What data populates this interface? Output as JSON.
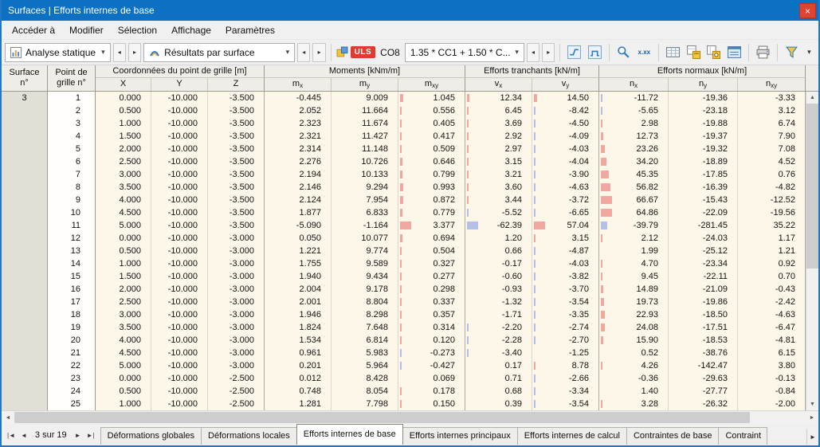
{
  "window": {
    "title": "Surfaces | Efforts internes de base"
  },
  "icons": {
    "close": "×",
    "chevron_down": "▾",
    "arrow_left": "◂",
    "arrow_right": "▸",
    "scroll_up": "▲",
    "scroll_down": "▼",
    "scroll_left": "◄",
    "scroll_right": "►",
    "nav_first": "|◄",
    "nav_prev": "◄",
    "nav_next": "►",
    "nav_last": "►|",
    "tab_scroll_right": "►",
    "decimal_places": "x.xx"
  },
  "menu": {
    "items": [
      "Accéder à",
      "Modifier",
      "Sélection",
      "Affichage",
      "Paramètres"
    ]
  },
  "toolbar": {
    "analysis_label": "Analyse statique",
    "results_label": "Résultats par surface",
    "design_situation": "ULS",
    "combination_id": "CO8",
    "combination_label": "1.35 * CC1 + 1.50 * C..."
  },
  "table": {
    "surface_header": "Surface\nn°",
    "point_header": "Point de\ngrille n°",
    "surface_number": "3",
    "groups": [
      {
        "label": "Coordonnées du point de grille [m]",
        "cols": [
          {
            "base": "X",
            "sub": ""
          },
          {
            "base": "Y",
            "sub": ""
          },
          {
            "base": "Z",
            "sub": ""
          }
        ]
      },
      {
        "label": "Moments [kNm/m]",
        "cols": [
          {
            "base": "m",
            "sub": "x"
          },
          {
            "base": "m",
            "sub": "y"
          },
          {
            "base": "m",
            "sub": "xy"
          }
        ]
      },
      {
        "label": "Efforts tranchants [kN/m]",
        "cols": [
          {
            "base": "v",
            "sub": "x"
          },
          {
            "base": "v",
            "sub": "y"
          }
        ]
      },
      {
        "label": "Efforts normaux [kN/m]",
        "cols": [
          {
            "base": "n",
            "sub": "x"
          },
          {
            "base": "n",
            "sub": "y"
          },
          {
            "base": "n",
            "sub": "xy"
          }
        ]
      }
    ],
    "rows": [
      [
        "1",
        "0.000",
        "-10.000",
        "-3.500",
        "-0.445",
        "9.009",
        "1.045",
        "12.34",
        "14.50",
        "-11.72",
        "-19.36",
        "-3.33"
      ],
      [
        "2",
        "0.500",
        "-10.000",
        "-3.500",
        "2.052",
        "11.664",
        "0.556",
        "6.45",
        "-8.42",
        "-5.65",
        "-23.18",
        "3.12"
      ],
      [
        "3",
        "1.000",
        "-10.000",
        "-3.500",
        "2.323",
        "11.674",
        "0.405",
        "3.69",
        "-4.50",
        "2.98",
        "-19.88",
        "6.74"
      ],
      [
        "4",
        "1.500",
        "-10.000",
        "-3.500",
        "2.321",
        "11.427",
        "0.417",
        "2.92",
        "-4.09",
        "12.73",
        "-19.37",
        "7.90"
      ],
      [
        "5",
        "2.000",
        "-10.000",
        "-3.500",
        "2.314",
        "11.148",
        "0.509",
        "2.97",
        "-4.03",
        "23.26",
        "-19.32",
        "7.08"
      ],
      [
        "6",
        "2.500",
        "-10.000",
        "-3.500",
        "2.276",
        "10.726",
        "0.646",
        "3.15",
        "-4.04",
        "34.20",
        "-18.89",
        "4.52"
      ],
      [
        "7",
        "3.000",
        "-10.000",
        "-3.500",
        "2.194",
        "10.133",
        "0.799",
        "3.21",
        "-3.90",
        "45.35",
        "-17.85",
        "0.76"
      ],
      [
        "8",
        "3.500",
        "-10.000",
        "-3.500",
        "2.146",
        "9.294",
        "0.993",
        "3.60",
        "-4.63",
        "56.82",
        "-16.39",
        "-4.82"
      ],
      [
        "9",
        "4.000",
        "-10.000",
        "-3.500",
        "2.124",
        "7.954",
        "0.872",
        "3.44",
        "-3.72",
        "66.67",
        "-15.43",
        "-12.52"
      ],
      [
        "10",
        "4.500",
        "-10.000",
        "-3.500",
        "1.877",
        "6.833",
        "0.779",
        "-5.52",
        "-6.65",
        "64.86",
        "-22.09",
        "-19.56"
      ],
      [
        "11",
        "5.000",
        "-10.000",
        "-3.500",
        "-5.090",
        "-1.164",
        "3.377",
        "-62.39",
        "57.04",
        "-39.79",
        "-281.45",
        "35.22"
      ],
      [
        "12",
        "0.000",
        "-10.000",
        "-3.000",
        "0.050",
        "10.077",
        "0.694",
        "1.20",
        "3.15",
        "2.12",
        "-24.03",
        "1.17"
      ],
      [
        "13",
        "0.500",
        "-10.000",
        "-3.000",
        "1.221",
        "9.774",
        "0.504",
        "0.66",
        "-4.87",
        "1.99",
        "-25.12",
        "1.21"
      ],
      [
        "14",
        "1.000",
        "-10.000",
        "-3.000",
        "1.755",
        "9.589",
        "0.327",
        "-0.17",
        "-4.03",
        "4.70",
        "-23.34",
        "0.92"
      ],
      [
        "15",
        "1.500",
        "-10.000",
        "-3.000",
        "1.940",
        "9.434",
        "0.277",
        "-0.60",
        "-3.82",
        "9.45",
        "-22.11",
        "0.70"
      ],
      [
        "16",
        "2.000",
        "-10.000",
        "-3.000",
        "2.004",
        "9.178",
        "0.298",
        "-0.93",
        "-3.70",
        "14.89",
        "-21.09",
        "-0.43"
      ],
      [
        "17",
        "2.500",
        "-10.000",
        "-3.000",
        "2.001",
        "8.804",
        "0.337",
        "-1.32",
        "-3.54",
        "19.73",
        "-19.86",
        "-2.42"
      ],
      [
        "18",
        "3.000",
        "-10.000",
        "-3.000",
        "1.946",
        "8.298",
        "0.357",
        "-1.71",
        "-3.35",
        "22.93",
        "-18.50",
        "-4.63"
      ],
      [
        "19",
        "3.500",
        "-10.000",
        "-3.000",
        "1.824",
        "7.648",
        "0.314",
        "-2.20",
        "-2.74",
        "24.08",
        "-17.51",
        "-6.47"
      ],
      [
        "20",
        "4.000",
        "-10.000",
        "-3.000",
        "1.534",
        "6.814",
        "0.120",
        "-2.28",
        "-2.70",
        "15.90",
        "-18.53",
        "-4.81"
      ],
      [
        "21",
        "4.500",
        "-10.000",
        "-3.000",
        "0.961",
        "5.983",
        "-0.273",
        "-3.40",
        "-1.25",
        "0.52",
        "-38.76",
        "6.15"
      ],
      [
        "22",
        "5.000",
        "-10.000",
        "-3.000",
        "0.201",
        "5.964",
        "-0.427",
        "0.17",
        "8.78",
        "4.26",
        "-142.47",
        "3.80"
      ],
      [
        "23",
        "0.000",
        "-10.000",
        "-2.500",
        "0.012",
        "8.428",
        "0.069",
        "0.71",
        "-2.66",
        "-0.36",
        "-29.63",
        "-0.13"
      ],
      [
        "24",
        "0.500",
        "-10.000",
        "-2.500",
        "0.748",
        "8.054",
        "0.178",
        "0.68",
        "-3.34",
        "1.40",
        "-27.77",
        "-0.84"
      ],
      [
        "25",
        "1.000",
        "-10.000",
        "-2.500",
        "1.281",
        "7.798",
        "0.150",
        "0.39",
        "-3.54",
        "3.28",
        "-26.32",
        "-2.00"
      ]
    ]
  },
  "footer": {
    "nav_label": "3 sur 19",
    "tabs": [
      {
        "label": "Déformations globales",
        "active": false
      },
      {
        "label": "Déformations locales",
        "active": false
      },
      {
        "label": "Efforts internes de base",
        "active": true
      },
      {
        "label": "Efforts internes principaux",
        "active": false
      },
      {
        "label": "Efforts internes de calcul",
        "active": false
      },
      {
        "label": "Contraintes de base",
        "active": false
      },
      {
        "label": "Contraint",
        "active": false,
        "truncated": true
      }
    ]
  },
  "colors": {
    "titlebar": "#0c71c3",
    "uls_badge": "#e23b2e",
    "bar_positive": "#f0a8a0",
    "bar_negative": "#b4c0e8",
    "accent_blue": "#2e7cc0"
  }
}
